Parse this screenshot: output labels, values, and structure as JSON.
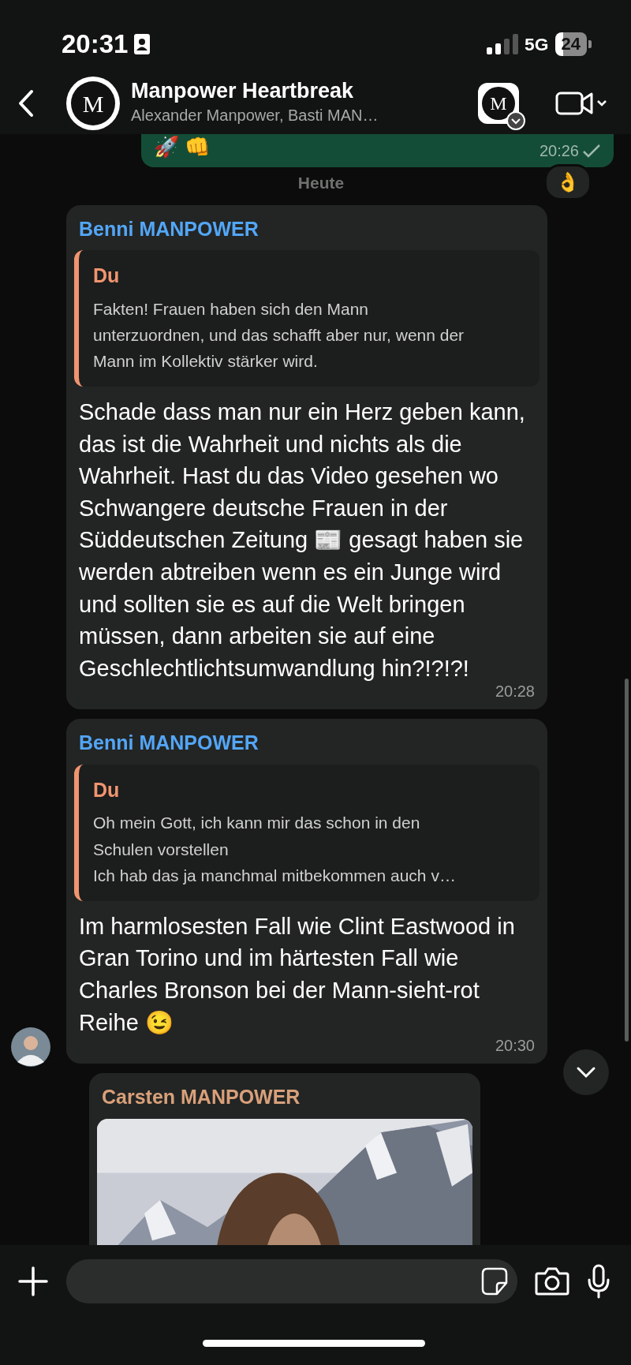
{
  "status_bar": {
    "time": "20:31",
    "network": "5G",
    "battery": "24"
  },
  "header": {
    "avatar_letter": "M",
    "title": "Manpower Heartbreak",
    "subtitle": "Alexander Manpower, Basti MAN…",
    "community_letter": "M"
  },
  "messages": [
    {
      "kind": "outgoing",
      "text": "🚀 👊",
      "time": "20:26",
      "read": false,
      "reaction": "👌"
    },
    {
      "kind": "date",
      "text": "Heute"
    },
    {
      "kind": "incoming",
      "sender": "Benni MANPOWER",
      "color": "#53a6f7",
      "quote": {
        "author": "Du",
        "color": "#f0956f",
        "text": "Fakten! Frauen haben sich den Mann unterzuordnen, und das schafft aber nur, wenn der Mann im Kollektiv stärker wird."
      },
      "text": "Schade dass man nur ein Herz geben kann, das ist die Wahrheit und nichts als die Wahrheit. Hast du das Video gesehen wo Schwangere deutsche Frauen in der Süddeutschen Zeitung 📰 gesagt haben sie werden abtreiben wenn es ein Junge wird und sollten sie es auf die Welt bringen müssen, dann arbeiten sie auf eine Geschlechtlichtsumwandlung hin?!?!?!",
      "time": "20:28",
      "avatar": false
    },
    {
      "kind": "incoming",
      "sender": "Benni MANPOWER",
      "color": "#53a6f7",
      "quote": {
        "author": "Du",
        "color": "#f0956f",
        "text": "Oh mein Gott, ich kann mir das schon in den Schulen vorstellen\nIch hab das ja manchmal mitbekommen auch v…"
      },
      "text": "Im harmlosesten Fall wie Clint Eastwood in Gran Torino und im härtesten Fall wie Charles Bronson bei der Mann-sieht-rot Reihe 😉",
      "time": "20:30",
      "avatar": true
    },
    {
      "sender": "Carsten MANPOWER",
      "color": "#d9a07a"
    }
  ]
}
